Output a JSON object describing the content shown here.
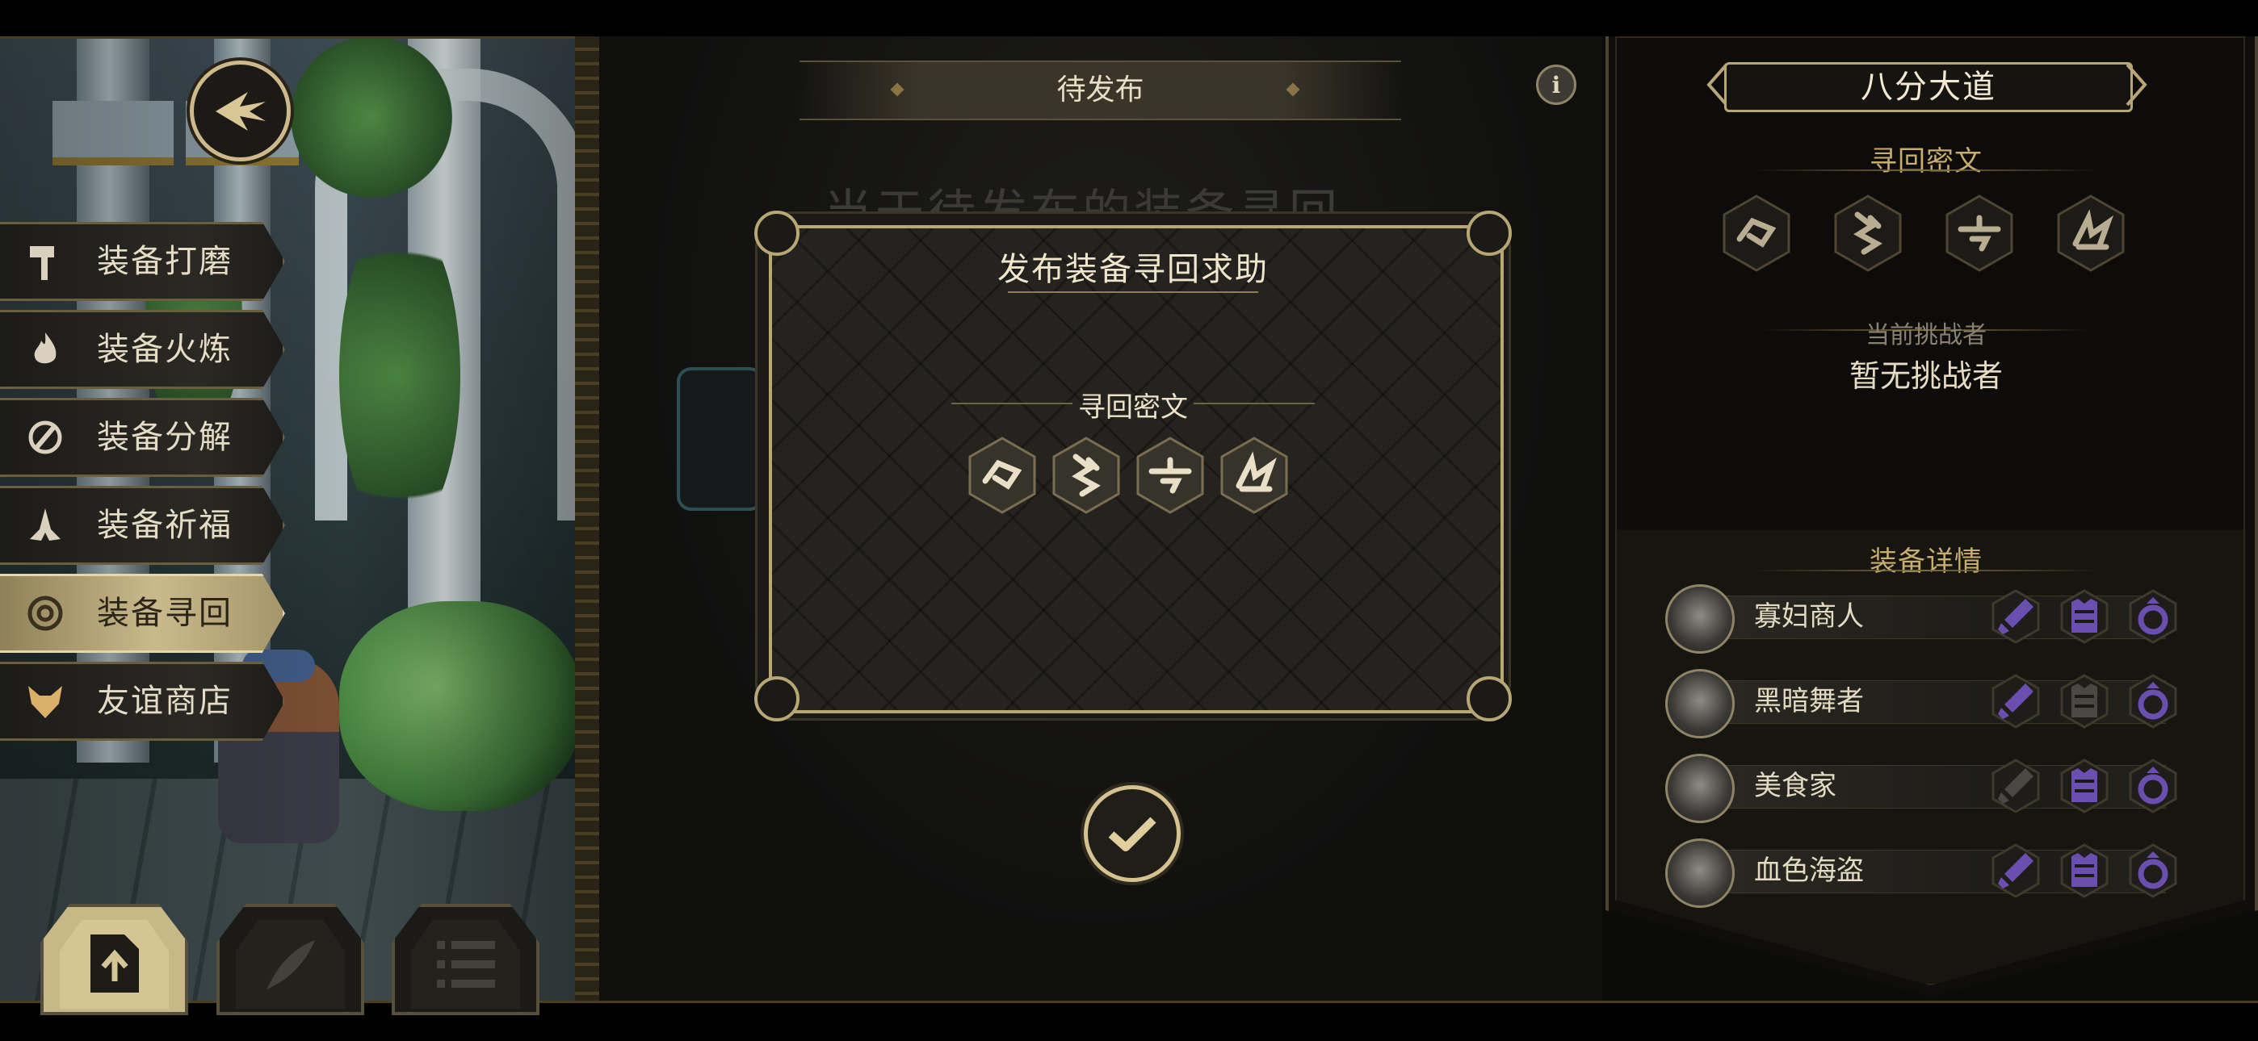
{
  "center": {
    "title": "待发布",
    "ghost_text": "当于待发布的装备寻回"
  },
  "menu": {
    "items": [
      {
        "label": "装备打磨",
        "icon": "hammer-icon"
      },
      {
        "label": "装备火炼",
        "icon": "flame-icon"
      },
      {
        "label": "装备分解",
        "icon": "disassemble-icon"
      },
      {
        "label": "装备祈福",
        "icon": "prayer-hands-icon"
      },
      {
        "label": "装备寻回",
        "icon": "target-icon",
        "active": true
      },
      {
        "label": "友谊商店",
        "icon": "fox-icon"
      }
    ]
  },
  "modal": {
    "title": "发布装备寻回求助",
    "subtitle": "寻回密文",
    "runes": [
      "rune-glyph-1",
      "rune-glyph-2",
      "rune-glyph-3",
      "rune-glyph-4"
    ]
  },
  "right": {
    "title": "八分大道",
    "cipher_title": "寻回密文",
    "challenger_label": "当前挑战者",
    "challenger_value": "暂无挑战者",
    "details_title": "装备详情",
    "rows": [
      {
        "name": "寡妇商人",
        "weapon": true,
        "armor": true,
        "ring": true
      },
      {
        "name": "黑暗舞者",
        "weapon": true,
        "armor": false,
        "ring": true
      },
      {
        "name": "美食家",
        "weapon": false,
        "armor": true,
        "ring": true
      },
      {
        "name": "血色海盗",
        "weapon": true,
        "armor": true,
        "ring": true
      }
    ]
  },
  "colors": {
    "gold": "#c7ad6e",
    "frame_gold": "#b8a773",
    "equip_purple": "#6a4fb0",
    "equip_grey": "#4a4843"
  }
}
